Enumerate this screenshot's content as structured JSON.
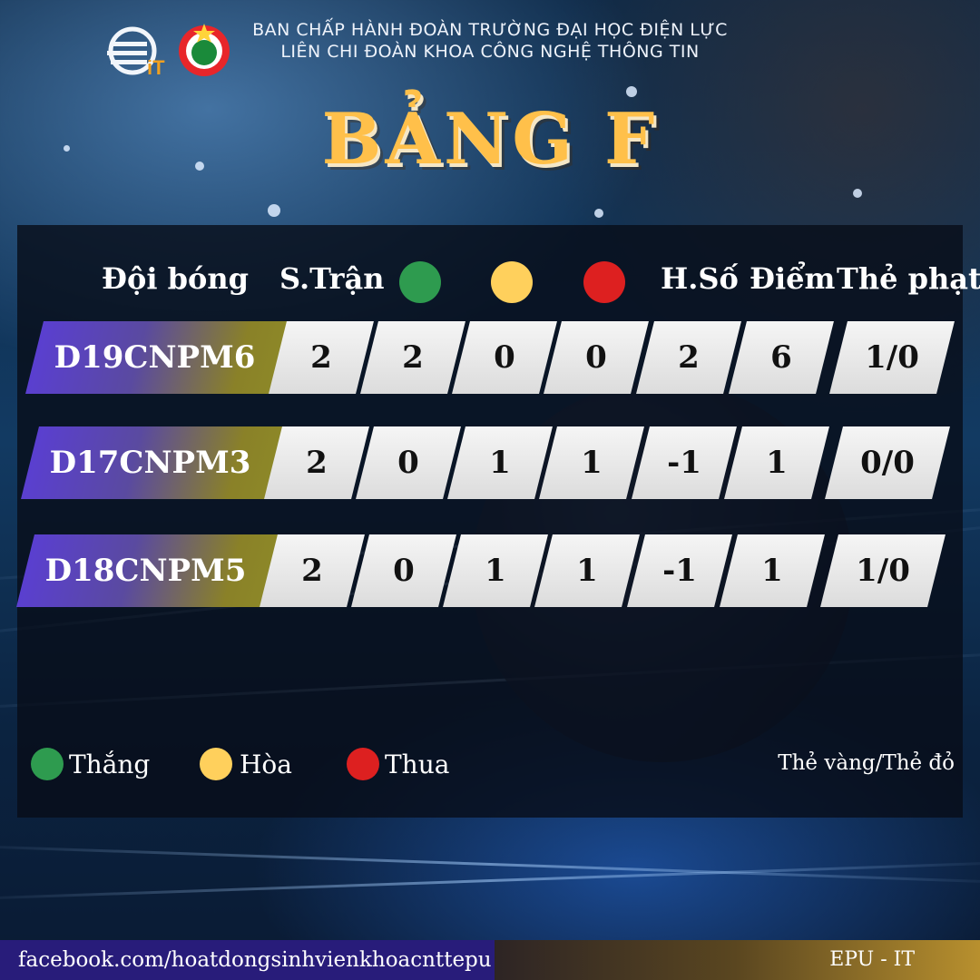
{
  "header": {
    "org_line_1": "BAN CHẤP HÀNH ĐOÀN TRƯỜNG ĐẠI HỌC ĐIỆN LỰC",
    "org_line_2": "LIÊN CHI ĐOÀN KHOA CÔNG NGHỆ THÔNG TIN",
    "logo_it_text": "iT",
    "logos": [
      "it-faculty-logo",
      "youth-union-logo"
    ]
  },
  "title": "BẢNG F",
  "table": {
    "columns": [
      "Đội bóng",
      "S.Trận",
      "",
      "",
      "",
      "H.Số",
      "Điểm",
      "Thẻ phạt"
    ],
    "dot_colors": {
      "win": "#2e9b4f",
      "draw": "#ffd05c",
      "loss": "#dd2020"
    },
    "rows": [
      {
        "team": "D19CNPM6",
        "played": "2",
        "won": "2",
        "draw": "0",
        "lost": "0",
        "goal_diff": "2",
        "points": "6",
        "cards": "1/0"
      },
      {
        "team": "D17CNPM3",
        "played": "2",
        "won": "0",
        "draw": "1",
        "lost": "1",
        "goal_diff": "-1",
        "points": "1",
        "cards": "0/0"
      },
      {
        "team": "D18CNPM5",
        "played": "2",
        "won": "0",
        "draw": "1",
        "lost": "1",
        "goal_diff": "-1",
        "points": "1",
        "cards": "1/0"
      }
    ]
  },
  "legend": {
    "win": "Thắng",
    "draw": "Hòa",
    "loss": "Thua",
    "cards_note": "Thẻ vàng/Thẻ đỏ"
  },
  "footer": {
    "facebook": "facebook.com/hoatdongsinhvienkhoacnttepu",
    "brand": "EPU - IT"
  },
  "colors": {
    "title": "#ffc04a",
    "footer_left": "#281c7a"
  }
}
